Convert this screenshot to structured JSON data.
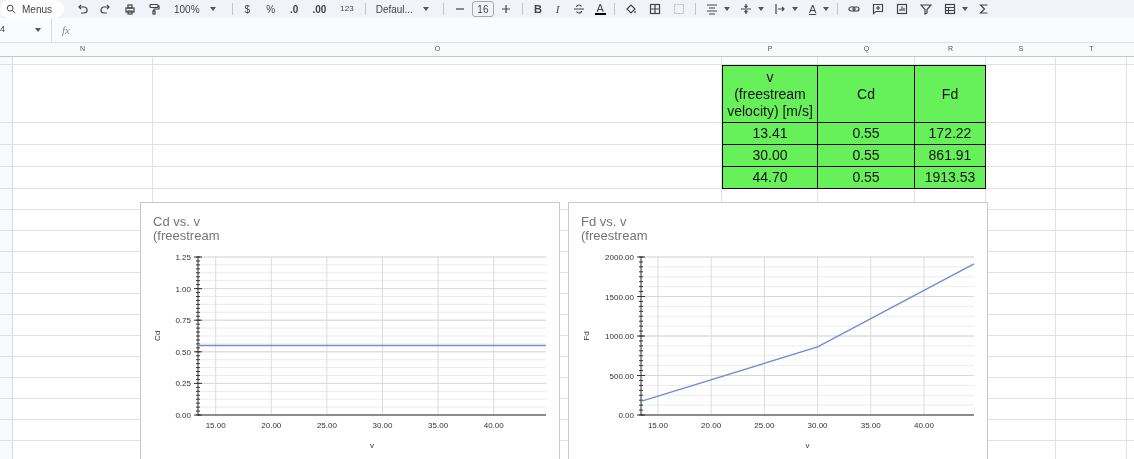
{
  "toolbar": {
    "search_label": "Menus",
    "zoom": "100%",
    "currency": "$",
    "percent": "%",
    "decrease_decimal": ".0",
    "increase_decimal": ".00",
    "number_format": "123",
    "font": "Defaul...",
    "font_size": "16",
    "bold": "B",
    "italic": "I",
    "text_color": "A",
    "text_rotation": "A"
  },
  "formula_bar": {
    "name_box": "4",
    "fx": "fx"
  },
  "column_headers": [
    "N",
    "O",
    "P",
    "Q",
    "R",
    "S",
    "T"
  ],
  "table": {
    "header": [
      "v\n(freestream velocity) [m/s]",
      "Cd",
      "Fd"
    ],
    "rows": [
      [
        "13.41",
        "0.55",
        "172.22"
      ],
      [
        "30.00",
        "0.55",
        "861.91"
      ],
      [
        "44.70",
        "0.55",
        "1913.53"
      ]
    ]
  },
  "charts": [
    {
      "title": "Cd vs. v\n(freestream",
      "chart_data": {
        "type": "line",
        "grid": true,
        "xlabel": "v",
        "ylabel": "Cd",
        "x": [
          13.41,
          30.0,
          44.7
        ],
        "series": [
          {
            "color": "#6f8fd6",
            "values": [
              0.55,
              0.55,
              0.55
            ]
          }
        ],
        "xlim": [
          13.41,
          44.7
        ],
        "ylim": [
          0,
          1.25
        ],
        "xticks": [
          {
            "value": 15,
            "label": "15.00"
          },
          {
            "value": 20,
            "label": "20.00"
          },
          {
            "value": 25,
            "label": "25.00"
          },
          {
            "value": 30,
            "label": "30.00"
          },
          {
            "value": 35,
            "label": "35.00"
          },
          {
            "value": 40,
            "label": "40.00"
          }
        ],
        "yticks": [
          {
            "value": 0,
            "label": "0.00"
          },
          {
            "value": 0.25,
            "label": "0.25"
          },
          {
            "value": 0.5,
            "label": "0.50"
          },
          {
            "value": 0.75,
            "label": "0.75"
          },
          {
            "value": 1,
            "label": "1.00"
          },
          {
            "value": 1.25,
            "label": "1.25"
          }
        ]
      }
    },
    {
      "title": "Fd vs. v\n(freestream",
      "chart_data": {
        "type": "line",
        "grid": true,
        "xlabel": "v",
        "ylabel": "Fd",
        "x": [
          13.41,
          30.0,
          44.7
        ],
        "series": [
          {
            "color": "#6f8fd6",
            "values": [
              172.22,
              861.91,
              1913.53
            ]
          }
        ],
        "xlim": [
          13.41,
          44.7
        ],
        "ylim": [
          0,
          2000
        ],
        "xticks": [
          {
            "value": 15,
            "label": "15.00"
          },
          {
            "value": 20,
            "label": "20.00"
          },
          {
            "value": 25,
            "label": "25.00"
          },
          {
            "value": 30,
            "label": "30.00"
          },
          {
            "value": 35,
            "label": "35.00"
          },
          {
            "value": 40,
            "label": "40.00"
          }
        ],
        "yticks": [
          {
            "value": 0,
            "label": "0.00"
          },
          {
            "value": 500,
            "label": "500.00"
          },
          {
            "value": 1000,
            "label": "1000.00"
          },
          {
            "value": 1500,
            "label": "1500.00"
          },
          {
            "value": 2000,
            "label": "2000.00"
          }
        ]
      }
    }
  ]
}
